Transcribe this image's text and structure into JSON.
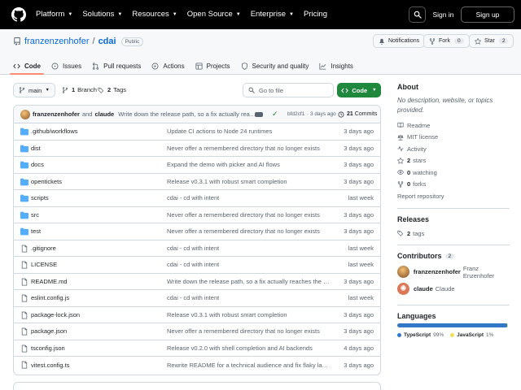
{
  "colors": {
    "accent": "#0969da",
    "green": "#1f883d",
    "tab_underline": "#fd8c73",
    "typescript": "#3178c6",
    "javascript": "#f1e05a"
  },
  "topnav": {
    "items": [
      {
        "label": "Platform"
      },
      {
        "label": "Solutions"
      },
      {
        "label": "Resources"
      },
      {
        "label": "Open Source"
      },
      {
        "label": "Enterprise"
      },
      {
        "label": "Pricing"
      }
    ],
    "sign_in": "Sign in",
    "sign_up": "Sign up"
  },
  "repo": {
    "owner": "franzenzenhofer",
    "slash": "/",
    "name": "cdai",
    "visibility": "Public",
    "notifications_label": "Notifications",
    "fork_label": "Fork",
    "fork_count": "0",
    "star_label": "Star",
    "star_count": "2"
  },
  "tabs": [
    {
      "label": "Code",
      "icon": "code-icon"
    },
    {
      "label": "Issues",
      "icon": "issue-icon"
    },
    {
      "label": "Pull requests",
      "icon": "pull-request-icon"
    },
    {
      "label": "Actions",
      "icon": "play-icon"
    },
    {
      "label": "Projects",
      "icon": "table-icon"
    },
    {
      "label": "Security and quality",
      "icon": "shield-icon"
    },
    {
      "label": "Insights",
      "icon": "graph-icon"
    }
  ],
  "toolbar": {
    "branch": "main",
    "branch_count": "1",
    "branch_label": "Branch",
    "tag_count": "2",
    "tag_label": "Tags",
    "goto_placeholder": "Go to file",
    "code_label": "Code"
  },
  "latest_commit": {
    "author": "franzenzenhofer",
    "and": "and",
    "coauthor": "claude",
    "message": "Write down the release path, so a fix actually reache...",
    "hash": "bfd2cf1",
    "ago": "· 3 days ago",
    "commit_count": "21",
    "commit_label": "Commits"
  },
  "files": [
    {
      "name": ".github/workflows",
      "type": "dir",
      "message": "Update CI actions to Node 24 runtimes",
      "date": "3 days ago"
    },
    {
      "name": "dist",
      "type": "dir",
      "message": "Never offer a remembered directory that no longer exists",
      "date": "3 days ago"
    },
    {
      "name": "docs",
      "type": "dir",
      "message": "Expand the demo with picker and AI flows",
      "date": "3 days ago"
    },
    {
      "name": "opentickets",
      "type": "dir",
      "message": "Release v0.3.1 with robust smart completion",
      "date": "3 days ago"
    },
    {
      "name": "scripts",
      "type": "dir",
      "message": "cdai - cd with intent",
      "date": "last week"
    },
    {
      "name": "src",
      "type": "dir",
      "message": "Never offer a remembered directory that no longer exists",
      "date": "3 days ago"
    },
    {
      "name": "test",
      "type": "dir",
      "message": "Never offer a remembered directory that no longer exists",
      "date": "3 days ago"
    },
    {
      "name": ".gitignore",
      "type": "file",
      "message": "cdai - cd with intent",
      "date": "last week"
    },
    {
      "name": "LICENSE",
      "type": "file",
      "message": "cdai - cd with intent",
      "date": "last week"
    },
    {
      "name": "README.md",
      "type": "file",
      "message": "Write down the release path, so a fix actually reaches the in...",
      "date": "3 days ago"
    },
    {
      "name": "eslint.config.js",
      "type": "file",
      "message": "cdai - cd with intent",
      "date": "last week"
    },
    {
      "name": "package-lock.json",
      "type": "file",
      "message": "Release v0.3.1 with robust smart completion",
      "date": "3 days ago"
    },
    {
      "name": "package.json",
      "type": "file",
      "message": "Never offer a remembered directory that no longer exists",
      "date": "3 days ago"
    },
    {
      "name": "tsconfig.json",
      "type": "file",
      "message": "Release v0.2.0 with shell completion and AI backends",
      "date": "4 days ago"
    },
    {
      "name": "vitest.config.ts",
      "type": "file",
      "message": "Rewrite README for a technical audience and fix flaky laten...",
      "date": "3 days ago"
    }
  ],
  "about": {
    "heading": "About",
    "description": "No description, website, or topics provided.",
    "readme": "Readme",
    "license": "MIT license",
    "activity": "Activity",
    "stars_count": "2",
    "stars_label": "stars",
    "watching_count": "0",
    "watching_label": "watching",
    "forks_count": "0",
    "forks_label": "forks",
    "report": "Report repository"
  },
  "releases": {
    "heading": "Releases",
    "tags_count": "2",
    "tags_label": "tags"
  },
  "contributors": {
    "heading": "Contributors",
    "count": "2",
    "list": [
      {
        "login": "franzenzenhofer",
        "name": "Franz Enzenhofer"
      },
      {
        "login": "claude",
        "name": "Claude"
      }
    ]
  },
  "languages": {
    "heading": "Languages",
    "list": [
      {
        "name": "TypeScript",
        "percent": "99%",
        "share": 0.99
      },
      {
        "name": "JavaScript",
        "percent": "1%",
        "share": 0.01
      }
    ]
  }
}
